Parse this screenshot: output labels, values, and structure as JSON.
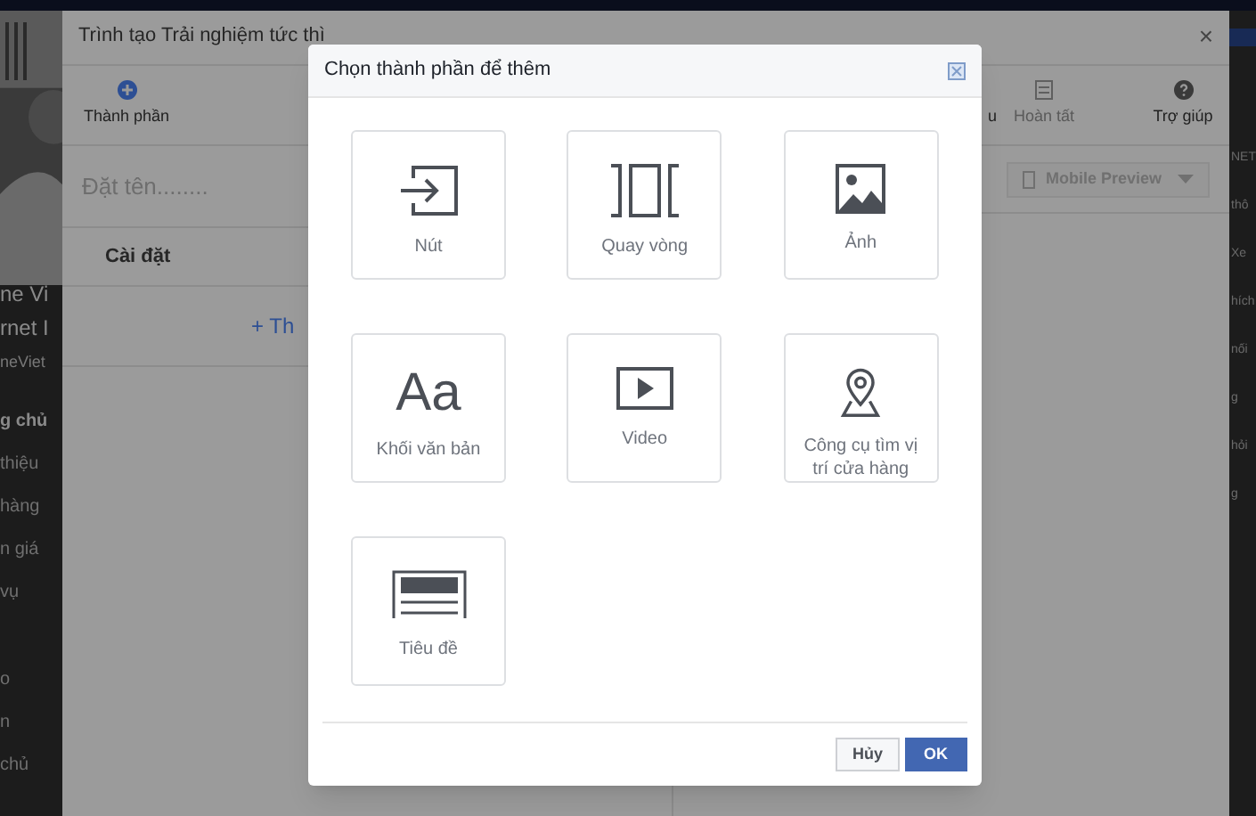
{
  "background_page": {
    "left_texts": [
      {
        "text": "ne Vi",
        "kind": "title"
      },
      {
        "text": "rnet I",
        "kind": "title"
      },
      {
        "text": "neViet",
        "kind": "subtitle"
      }
    ],
    "left_menu": [
      {
        "text": "g chủ",
        "kind": "bold"
      },
      {
        "text": "thiệu",
        "kind": "item"
      },
      {
        "text": "hàng",
        "kind": "item"
      },
      {
        "text": "n giá",
        "kind": "item"
      },
      {
        "text": "vụ",
        "kind": "item"
      }
    ],
    "left_menu_2": [
      "o",
      "n",
      "chủ"
    ],
    "right_texts": [
      "NET",
      "thô",
      "Xe",
      "hích",
      "nối",
      "g",
      "hỏi",
      "g"
    ]
  },
  "builder": {
    "title": "Trình tạo Trải nghiệm tức thì",
    "close": "×",
    "toolbar_left": [
      {
        "label": "Thành phần",
        "kind": "plus",
        "disabled": false
      }
    ],
    "toolbar_right": [
      {
        "label": "u",
        "kind": "partial",
        "disabled": false
      },
      {
        "label": "Hoàn tất",
        "kind": "checklist",
        "disabled": true
      },
      {
        "label": "Trợ giúp",
        "kind": "help",
        "disabled": false
      }
    ],
    "name_field": {
      "placeholder": "Đặt tên........"
    },
    "settings_label": "Cài đặt",
    "add_link": "+ Th",
    "preview_dropdown": "Mobile Preview"
  },
  "modal": {
    "title": "Chọn thành phần để thêm",
    "tiles": [
      {
        "label": "Nút",
        "kind": "button"
      },
      {
        "label": "Quay vòng",
        "kind": "carousel"
      },
      {
        "label": "Ảnh"
      },
      {
        "label": "Khối văn bản",
        "kind": "text",
        "icon_text": "Aa"
      },
      {
        "label": "Video",
        "kind": "video"
      },
      {
        "label": "Công cụ tìm vị trí cửa hàng",
        "kind": "locator"
      },
      {
        "label": "Tiêu đề",
        "kind": "header"
      }
    ],
    "buttons": [
      {
        "label": "Hủy",
        "kind": "secondary"
      },
      {
        "label": "OK",
        "kind": "primary"
      }
    ]
  }
}
